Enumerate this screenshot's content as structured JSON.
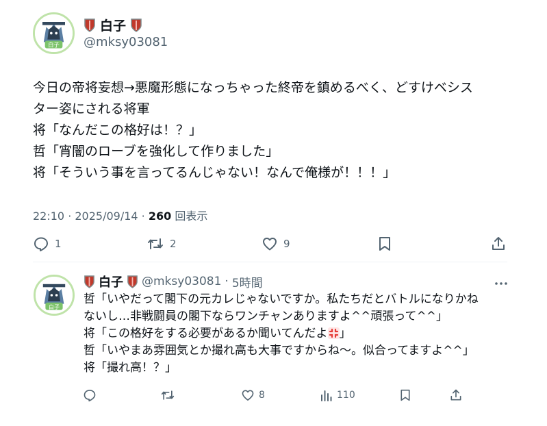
{
  "tweet": {
    "display_name": "白子",
    "handle": "@mksy03081",
    "lines": [
      "今日の帝将妄想→悪魔形態になっちゃった終帝を鎮めるべく、どすけベシス",
      "ター姿にされる将軍",
      "将「なんだこの格好は！？」",
      "哲「宵闇のローブを強化して作りました」",
      "将「そういう事を言ってるんじゃない！なんで俺様が！！！」"
    ],
    "time": "22:10 · 2025/09/14 · ",
    "views_count": "260",
    "views_label": " 回表示",
    "actions": {
      "reply_count": "1",
      "retweet_count": "2",
      "like_count": "9"
    }
  },
  "reply": {
    "display_name": "白子",
    "handle": "@mksy03081",
    "separator": "·",
    "time": "5時間",
    "lines": {
      "l1": "哲「いやだって閣下の元カレじゃないですか。私たちだとバトルになりかね",
      "l2": "ないし…非戦闘員の閣下ならワンチャンありますよ^^頑張って^^」",
      "l3_before": "将「この格好をする必要があるか聞いてんだよ",
      "l3_after": "」",
      "l4": "哲「いやまあ雰囲気とか撮れ高も大事ですからね〜。似合ってますよ^^」",
      "l5": "将「撮れ高！？」"
    },
    "actions": {
      "like_count": "8",
      "views_count": "110"
    }
  },
  "colors": {
    "shield_red": "#c0392b",
    "avatar_border": "#bfe3a9",
    "meta_gray": "#536471"
  },
  "avatar_text": "白子"
}
